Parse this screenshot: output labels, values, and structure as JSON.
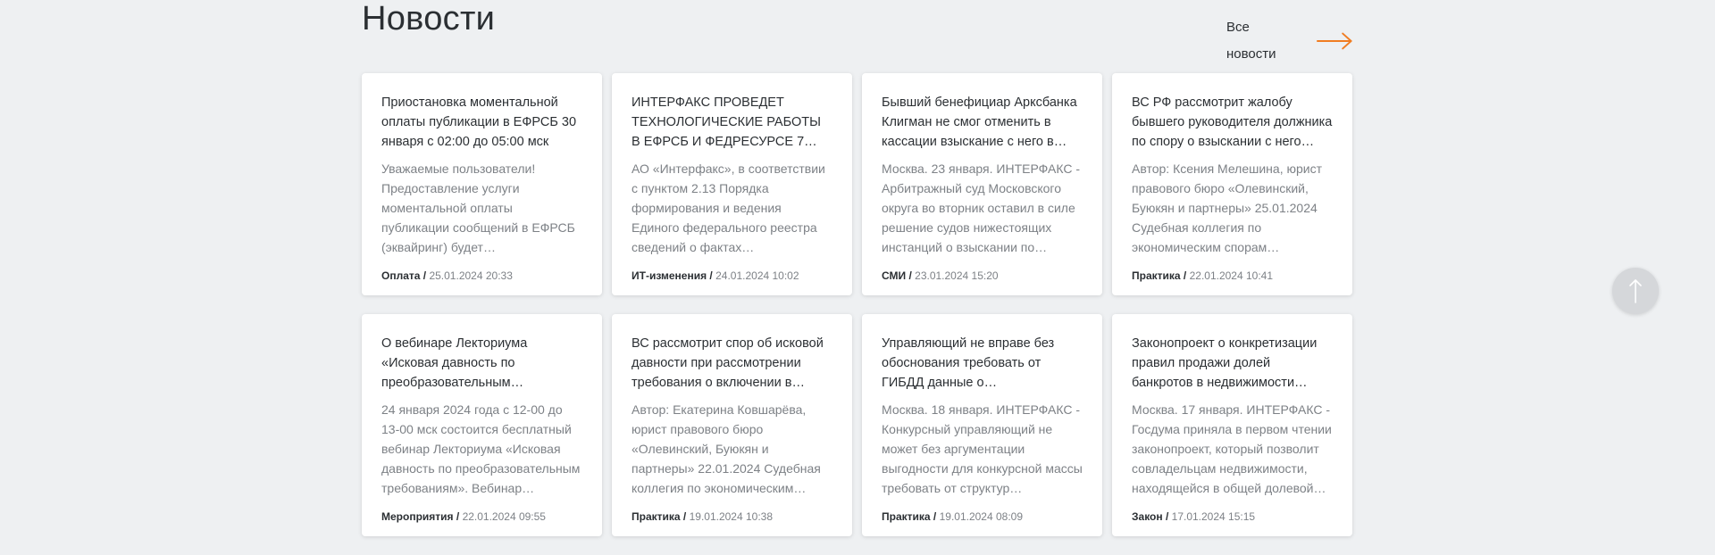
{
  "news": {
    "title": "Новости",
    "all_news_label": "Все новости",
    "accent_color": "#f07d22",
    "items": [
      {
        "title": "Приостановка моментальной оплаты публикации в ЕФРСБ 30 января с 02:00 до 05:00 мск",
        "text": "Уважаемые пользователи! Предоставление услуги моментальной оплаты публикации сообщений в ЕФРСБ (эквайринг) будет…",
        "category": "Оплата /",
        "date": "25.01.2024 20:33"
      },
      {
        "title": "ИНТЕРФАКС ПРОВЕДЕТ ТЕХНОЛОГИЧЕСКИЕ РАБОТЫ В ЕФРСБ И ФЕДРЕСУРСЕ 7…",
        "text": "АО «Интерфакс», в соответствии с пунктом 2.13 Порядка формирования и ведения Единого федерального реестра сведений о фактах деятельности…",
        "category": "ИТ-изменения /",
        "date": "24.01.2024 10:02"
      },
      {
        "title": "Бывший бенефициар Арксбанка Клигман не смог отменить в кассации взыскание с него в…",
        "text": "Москва. 23 января. ИНТЕРФАКС - Арбитражный суд Московского округа во вторник оставил в силе решение судов нижестоящих инстанций о взыскании по…",
        "category": "СМИ /",
        "date": "23.01.2024 15:20"
      },
      {
        "title": "ВС РФ рассмотрит жалобу бывшего руководителя должника по спору о взыскании с него…",
        "text": "Автор: Ксения Мелешина, юрист правового бюро «Олевинский, Буюкян и партнеры» 25.01.2024 Судебная коллегия по экономическим спорам…",
        "category": "Практика /",
        "date": "22.01.2024 10:41"
      },
      {
        "title": "О вебинаре Лекториума «Исковая давность по преобразовательным…",
        "text": "24 января 2024 года с 12-00 до 13-00 мск состоится бесплатный вебинар Лекториума «Исковая давность по преобразовательным требованиям». Вебинар проведе…",
        "category": "Мероприятия /",
        "date": "22.01.2024 09:55"
      },
      {
        "title": "ВС рассмотрит спор об исковой давности при рассмотрении требования о включении в…",
        "text": "Автор: Екатерина Ковшарёва, юрист правового бюро «Олевинский, Буюкян и партнеры» 22.01.2024 Судебная коллегия по экономическим спорам…",
        "category": "Практика /",
        "date": "19.01.2024 10:38"
      },
      {
        "title": "Управляющий не вправе без обоснования требовать от ГИБДД данные о передвижении…",
        "text": "Москва. 18 января. ИНТЕРФАКС - Конкурсный управляющий не может без аргументации выгодности для конкурсной массы требовать от структур…",
        "category": "Практика /",
        "date": "19.01.2024 08:09"
      },
      {
        "title": "Законопроект о конкретизации правил продажи долей банкротов в недвижимости…",
        "text": "Москва. 17 января. ИНТЕРФАКС - Госдума приняла в первом чтении законопроект, который позволит совладельцам недвижимости, находящейся в общей долевой…",
        "category": "Закон /",
        "date": "17.01.2024 15:15"
      }
    ]
  },
  "scroll_top": {
    "icon": "arrow-up-icon"
  }
}
